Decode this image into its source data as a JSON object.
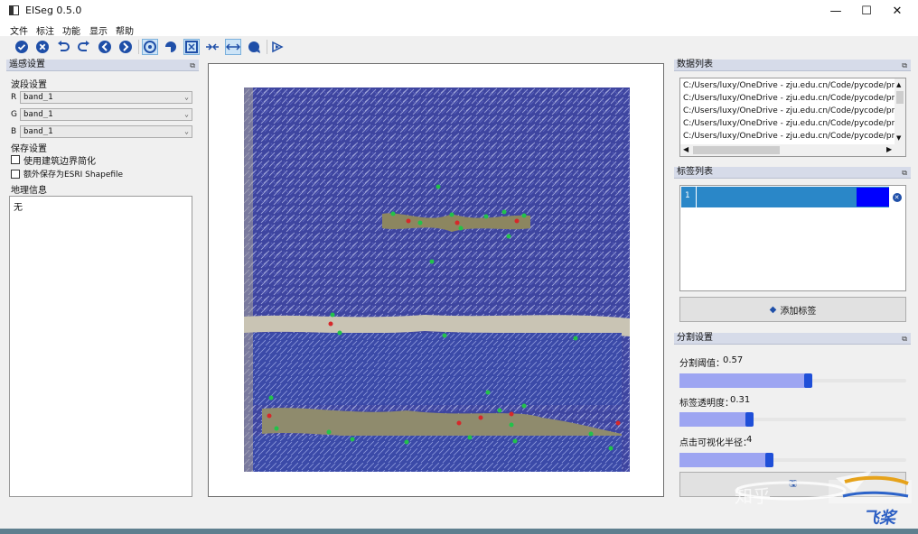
{
  "window": {
    "title": "EISeg 0.5.0",
    "minimize": "—",
    "maximize": "☐",
    "close": "✕"
  },
  "menu": [
    "文件",
    "标注",
    "功能",
    "显示",
    "帮助"
  ],
  "toolbar": {
    "icons": [
      "finish-icon",
      "clear-icon",
      "undo-icon",
      "redo-icon",
      "prev-image-icon",
      "next-image-icon",
      "polygon-interactive-icon",
      "segment-mode-icon",
      "crop-mode-icon",
      "shrink-scale-icon",
      "expand-scale-icon",
      "color-mask-icon",
      "recursive-icon"
    ],
    "accent": "#1f4fa8"
  },
  "left_panel": {
    "title": "遥感设置",
    "band_section": "波段设置",
    "bands": [
      {
        "channel": "R",
        "value": "band_1"
      },
      {
        "channel": "G",
        "value": "band_1"
      },
      {
        "channel": "B",
        "value": "band_1"
      }
    ],
    "save_section": "保存设置",
    "checkbox_simplify": "使用建筑边界简化",
    "checkbox_shapefile": "额外保存为ESRI Shapefile",
    "geo_section": "地理信息",
    "geo_value": "无"
  },
  "data_list": {
    "title": "数据列表",
    "items": [
      "C:/Users/luxy/OneDrive - zju.edu.cn/Code/pycode/proj",
      "C:/Users/luxy/OneDrive - zju.edu.cn/Code/pycode/proj",
      "C:/Users/luxy/OneDrive - zju.edu.cn/Code/pycode/proj",
      "C:/Users/luxy/OneDrive - zju.edu.cn/Code/pycode/proj",
      "C:/Users/luxy/OneDrive - zju.edu.cn/Code/pycode/proj"
    ]
  },
  "label_list": {
    "title": "标签列表",
    "labels": [
      {
        "id": "1",
        "color": "#0000ff"
      }
    ],
    "add_button": "添加标签"
  },
  "segmentation": {
    "title": "分割设置",
    "threshold_label": "分割阈值：",
    "threshold_value": "0.57",
    "threshold_fraction": 0.57,
    "opacity_label": "标签透明度：",
    "opacity_value": "0.31",
    "opacity_fraction": 0.31,
    "radius_label": "点击可视化半径：",
    "radius_value": "4",
    "radius_fraction": 0.4
  },
  "watermark": {
    "line1": "知乎",
    "line2": "飞桨"
  }
}
